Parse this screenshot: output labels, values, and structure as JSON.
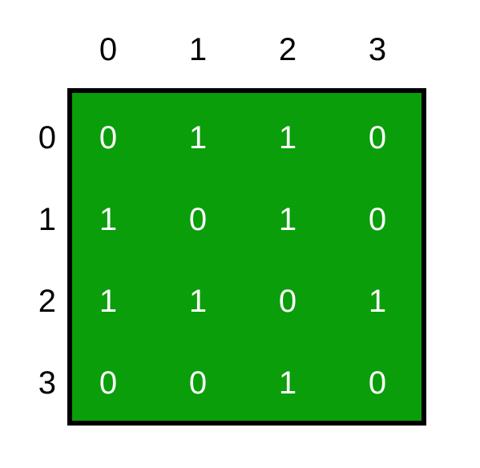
{
  "col_headers": [
    "0",
    "1",
    "2",
    "3"
  ],
  "row_headers": [
    "0",
    "1",
    "2",
    "3"
  ],
  "matrix": [
    [
      "0",
      "1",
      "1",
      "0"
    ],
    [
      "1",
      "0",
      "1",
      "0"
    ],
    [
      "1",
      "1",
      "0",
      "1"
    ],
    [
      "0",
      "0",
      "1",
      "0"
    ]
  ],
  "chart_data": {
    "type": "table",
    "title": "",
    "row_labels": [
      0,
      1,
      2,
      3
    ],
    "col_labels": [
      0,
      1,
      2,
      3
    ],
    "values": [
      [
        0,
        1,
        1,
        0
      ],
      [
        1,
        0,
        1,
        0
      ],
      [
        1,
        1,
        0,
        1
      ],
      [
        0,
        0,
        1,
        0
      ]
    ]
  }
}
